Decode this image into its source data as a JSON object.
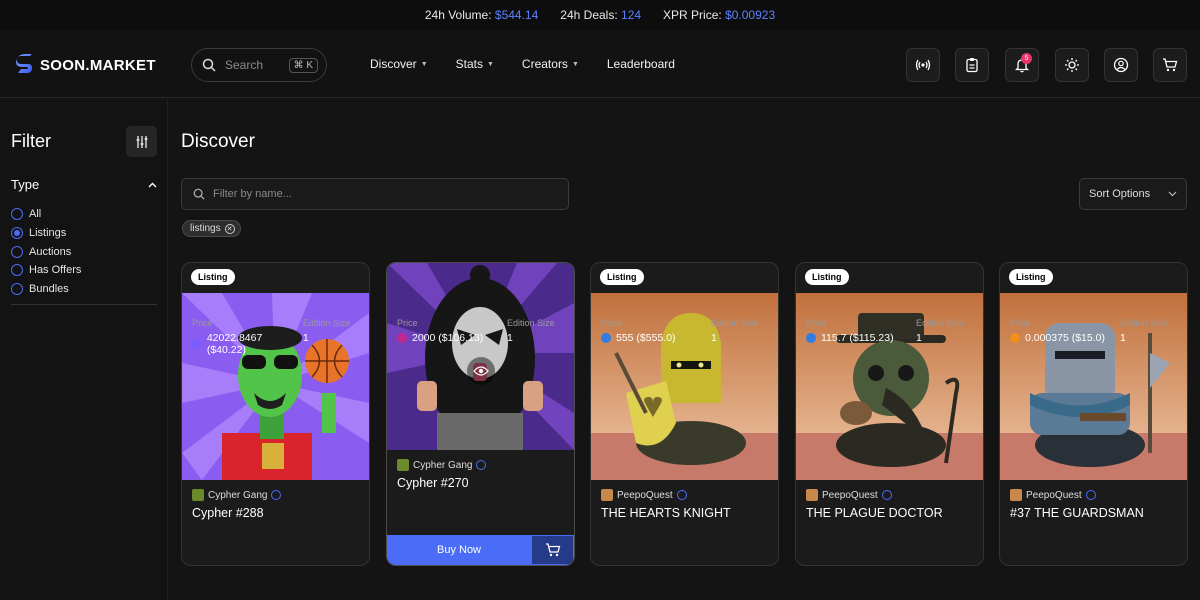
{
  "ticker": {
    "volume_label": "24h Volume:",
    "volume_value": "$544.14",
    "deals_label": "24h Deals:",
    "deals_value": "124",
    "price_label": "XPR Price:",
    "price_value": "$0.00923"
  },
  "nav": {
    "logo": "SOON.MARKET",
    "search_placeholder": "Search",
    "search_shortcut": "⌘ K",
    "menu": [
      {
        "label": "Discover"
      },
      {
        "label": "Stats"
      },
      {
        "label": "Creators"
      },
      {
        "label": "Leaderboard"
      }
    ],
    "notification_count": "5"
  },
  "sidebar": {
    "title": "Filter",
    "type_heading": "Type",
    "options": [
      "All",
      "Listings",
      "Auctions",
      "Has Offers",
      "Bundles"
    ],
    "selected": "Listings"
  },
  "main": {
    "title": "Discover",
    "name_filter_placeholder": "Filter by name...",
    "sort_label": "Sort Options",
    "active_tag": "listings",
    "price_label": "Price",
    "edition_label": "Edition Size",
    "buy_label": "Buy Now",
    "cards": [
      {
        "badge": "Listing",
        "collection": "Cypher Gang",
        "name": "Cypher #288",
        "price": "42022.8467 ($40.22)",
        "edition": "1",
        "token_color": "#7a5cff",
        "art": "cypher-288"
      },
      {
        "badge": "",
        "collection": "Cypher Gang",
        "name": "Cypher #270",
        "price": "2000 ($106.13)",
        "edition": "1",
        "token_color": "#c2278f",
        "art": "cypher-270"
      },
      {
        "badge": "Listing",
        "collection": "PeepoQuest",
        "name": "THE HEARTS KNIGHT",
        "price": "555 ($555.0)",
        "edition": "1",
        "token_color": "#2f7de1",
        "art": "hearts-knight"
      },
      {
        "badge": "Listing",
        "collection": "PeepoQuest",
        "name": "THE PLAGUE DOCTOR",
        "price": "115.7 ($115.23)",
        "edition": "1",
        "token_color": "#2f7de1",
        "art": "plague-doctor"
      },
      {
        "badge": "Listing",
        "collection": "PeepoQuest",
        "name": "#37 THE GUARDSMAN",
        "price": "0.000375 ($15.0)",
        "edition": "1",
        "token_color": "#f0901b",
        "art": "guardsman"
      }
    ]
  },
  "colors": {
    "accent": "#4a6cf7",
    "background": "#141414",
    "badge": "#e8336a"
  }
}
